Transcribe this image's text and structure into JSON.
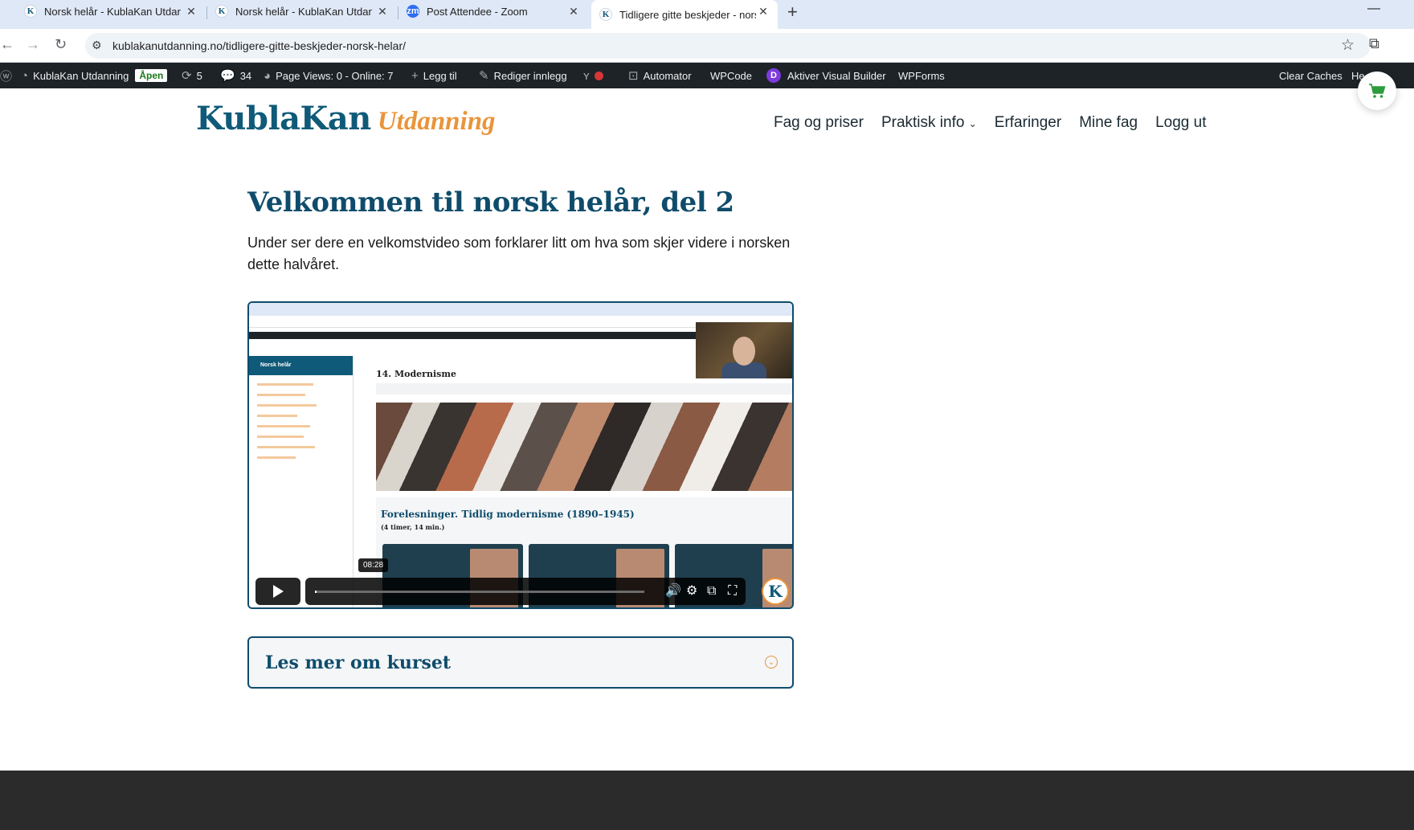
{
  "browser": {
    "tabs": [
      {
        "title": "Norsk helår - KublaKan Utdanning",
        "favicon": "k-logo-icon",
        "active": false
      },
      {
        "title": "Norsk helår - KublaKan Utdanning",
        "favicon": "k-logo-icon",
        "active": false
      },
      {
        "title": "Post Attendee - Zoom",
        "favicon": "zoom-icon",
        "active": false
      },
      {
        "title": "Tidligere gitte beskjeder - norsk",
        "favicon": "k-logo-icon",
        "active": true
      }
    ],
    "url": "kublakanutdanning.no/tidligere-gitte-beskjeder-norsk-helar/"
  },
  "adminbar": {
    "site_name": "KublaKan Utdanning",
    "status_badge": "Åpen",
    "updates_count": "5",
    "comments_count": "34",
    "page_views": "Page Views: 0 - Online: 7",
    "add_new": "Legg til",
    "edit_post": "Rediger innlegg",
    "automator": "Automator",
    "wpcode": "WPCode",
    "visual_builder": "Aktiver Visual Builder",
    "wpforms": "WPForms",
    "clear_caches": "Clear Caches",
    "howdy": "He"
  },
  "site": {
    "logo_main": "KublaKan",
    "logo_sub": "Utdanning",
    "nav": [
      "Fag og priser",
      "Praktisk info",
      "Erfaringer",
      "Mine fag",
      "Logg ut"
    ],
    "nav_dropdown_icon": "chevron-down-icon"
  },
  "content": {
    "title": "Velkommen til norsk helår, del 2",
    "intro": "Under ser dere en velkomstvideo som forklarer litt om hva som skjer videre i norsken dette halvåret.",
    "video": {
      "embedded_page_title": "14. Modernisme",
      "embedded_sidebar_title": "Norsk helår",
      "embedded_section_title": "Forelesninger. Tidlig modernisme (1890–1945)",
      "embedded_section_sub": "(4 timer, 14 min.)",
      "time": "08:28",
      "progress": 0.005
    },
    "accordion_title": "Les mer om kurset"
  },
  "colors": {
    "brand_blue": "#0f5a78",
    "brand_orange": "#e9943a",
    "adminbar_bg": "#1d2327",
    "cart_green": "#2e9b3c"
  }
}
